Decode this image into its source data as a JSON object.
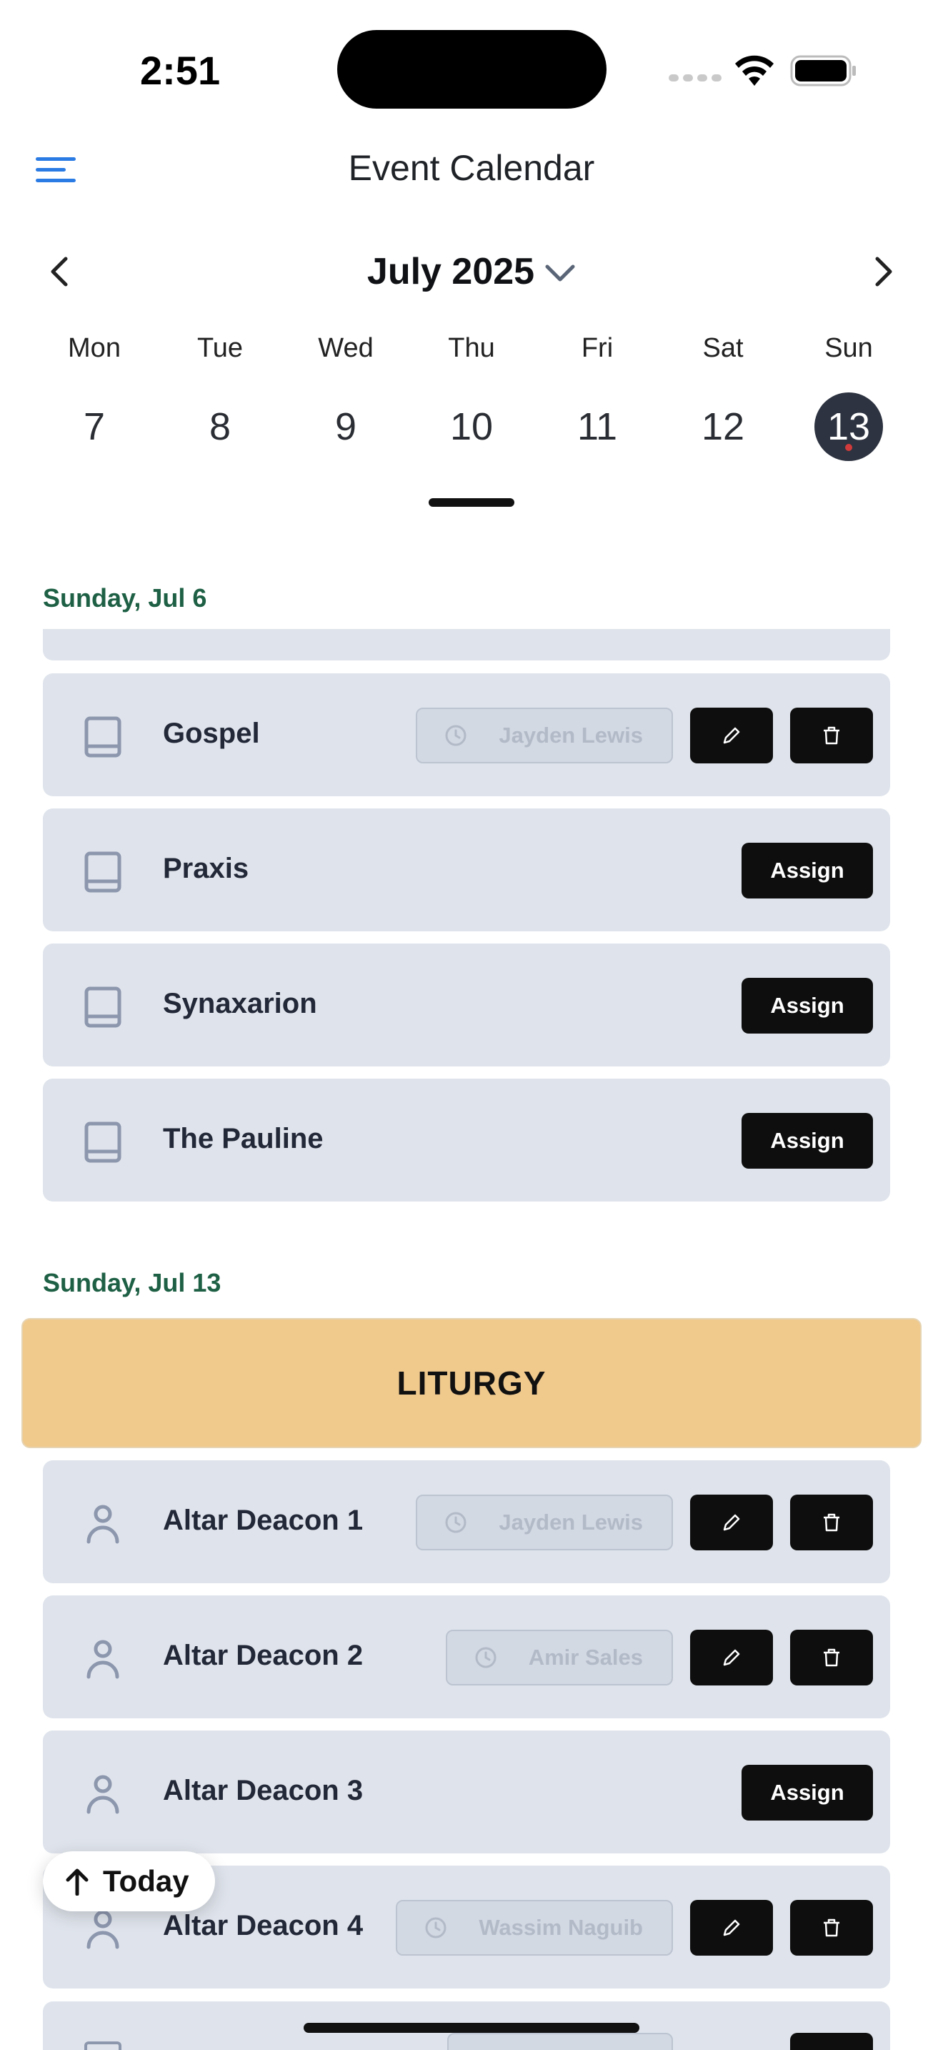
{
  "status_bar": {
    "time": "2:51"
  },
  "header": {
    "title": "Event Calendar"
  },
  "calendar": {
    "month_label": "July 2025",
    "weekdays": [
      "Mon",
      "Tue",
      "Wed",
      "Thu",
      "Fri",
      "Sat",
      "Sun"
    ],
    "days": [
      "7",
      "8",
      "9",
      "10",
      "11",
      "12",
      "13"
    ],
    "selected_day": "13"
  },
  "sections": [
    {
      "date": "Sunday, Jul 6",
      "items": [
        {
          "name": "Gospel",
          "icon": "book-icon",
          "assignee": "Jayden Lewis"
        },
        {
          "name": "Praxis",
          "icon": "book-icon",
          "action": "Assign"
        },
        {
          "name": "Synaxarion",
          "icon": "book-icon",
          "action": "Assign"
        },
        {
          "name": "The Pauline",
          "icon": "book-icon",
          "action": "Assign"
        }
      ]
    },
    {
      "date": "Sunday, Jul 13",
      "banner": "LITURGY",
      "items": [
        {
          "name": "Altar Deacon 1",
          "icon": "person-icon",
          "assignee": "Jayden Lewis"
        },
        {
          "name": "Altar Deacon 2",
          "icon": "person-icon",
          "assignee": "Amir Sales"
        },
        {
          "name": "Altar Deacon 3",
          "icon": "person-icon",
          "action": "Assign"
        },
        {
          "name": "Altar Deacon 4",
          "icon": "person-icon",
          "assignee": "Wassim Naguib"
        }
      ]
    }
  ],
  "today_button": {
    "label": "Today"
  },
  "colors": {
    "section_date": "#1e6045",
    "card_bg": "#dfe4ec",
    "banner_bg": "#f0c98d",
    "accent": "#2a7be4"
  }
}
